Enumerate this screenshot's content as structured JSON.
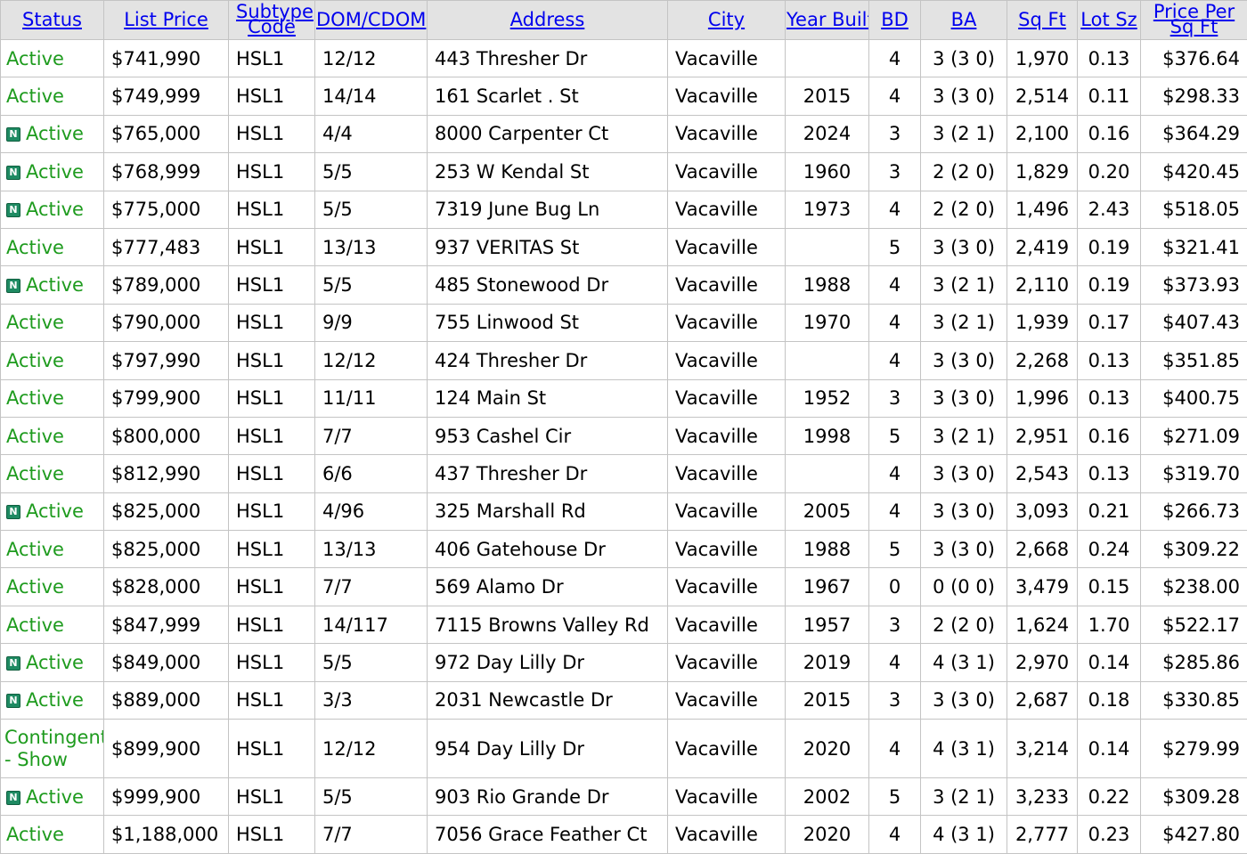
{
  "columns": [
    {
      "key": "status",
      "label": "Status",
      "width": 116
    },
    {
      "key": "list_price",
      "label": "List Price",
      "width": 140
    },
    {
      "key": "subtype",
      "label": "Subtype Code",
      "width": 97
    },
    {
      "key": "dom_cdom",
      "label": "DOM/CDOM",
      "width": 126
    },
    {
      "key": "address",
      "label": "Address",
      "width": 270
    },
    {
      "key": "city",
      "label": "City",
      "width": 132
    },
    {
      "key": "year_built",
      "label": "Year Built",
      "width": 94
    },
    {
      "key": "bd",
      "label": "BD",
      "width": 58
    },
    {
      "key": "ba",
      "label": "BA",
      "width": 97
    },
    {
      "key": "sqft",
      "label": "Sq Ft",
      "width": 79
    },
    {
      "key": "lot_sz",
      "label": "Lot Sz",
      "width": 71
    },
    {
      "key": "price_per_sqft",
      "label": "Price Per Sq Ft",
      "width": 120
    }
  ],
  "rows": [
    {
      "new": false,
      "status": "Active",
      "list_price": "$741,990",
      "subtype": "HSL1",
      "dom_cdom": "12/12",
      "address": "443 Thresher Dr",
      "city": "Vacaville",
      "year_built": "",
      "bd": "4",
      "ba": "3 (3 0)",
      "sqft": "1,970",
      "lot_sz": "0.13",
      "price_per_sqft": "$376.64"
    },
    {
      "new": false,
      "status": "Active",
      "list_price": "$749,999",
      "subtype": "HSL1",
      "dom_cdom": "14/14",
      "address": "161 Scarlet . St",
      "city": "Vacaville",
      "year_built": "2015",
      "bd": "4",
      "ba": "3 (3 0)",
      "sqft": "2,514",
      "lot_sz": "0.11",
      "price_per_sqft": "$298.33"
    },
    {
      "new": true,
      "status": "Active",
      "list_price": "$765,000",
      "subtype": "HSL1",
      "dom_cdom": "4/4",
      "address": "8000 Carpenter Ct",
      "city": "Vacaville",
      "year_built": "2024",
      "bd": "3",
      "ba": "3 (2 1)",
      "sqft": "2,100",
      "lot_sz": "0.16",
      "price_per_sqft": "$364.29"
    },
    {
      "new": true,
      "status": "Active",
      "list_price": "$768,999",
      "subtype": "HSL1",
      "dom_cdom": "5/5",
      "address": "253 W Kendal St",
      "city": "Vacaville",
      "year_built": "1960",
      "bd": "3",
      "ba": "2 (2 0)",
      "sqft": "1,829",
      "lot_sz": "0.20",
      "price_per_sqft": "$420.45"
    },
    {
      "new": true,
      "status": "Active",
      "list_price": "$775,000",
      "subtype": "HSL1",
      "dom_cdom": "5/5",
      "address": "7319 June Bug Ln",
      "city": "Vacaville",
      "year_built": "1973",
      "bd": "4",
      "ba": "2 (2 0)",
      "sqft": "1,496",
      "lot_sz": "2.43",
      "price_per_sqft": "$518.05"
    },
    {
      "new": false,
      "status": "Active",
      "list_price": "$777,483",
      "subtype": "HSL1",
      "dom_cdom": "13/13",
      "address": "937 VERITAS St",
      "city": "Vacaville",
      "year_built": "",
      "bd": "5",
      "ba": "3 (3 0)",
      "sqft": "2,419",
      "lot_sz": "0.19",
      "price_per_sqft": "$321.41"
    },
    {
      "new": true,
      "status": "Active",
      "list_price": "$789,000",
      "subtype": "HSL1",
      "dom_cdom": "5/5",
      "address": "485 Stonewood Dr",
      "city": "Vacaville",
      "year_built": "1988",
      "bd": "4",
      "ba": "3 (2 1)",
      "sqft": "2,110",
      "lot_sz": "0.19",
      "price_per_sqft": "$373.93"
    },
    {
      "new": false,
      "status": "Active",
      "list_price": "$790,000",
      "subtype": "HSL1",
      "dom_cdom": "9/9",
      "address": "755 Linwood St",
      "city": "Vacaville",
      "year_built": "1970",
      "bd": "4",
      "ba": "3 (2 1)",
      "sqft": "1,939",
      "lot_sz": "0.17",
      "price_per_sqft": "$407.43"
    },
    {
      "new": false,
      "status": "Active",
      "list_price": "$797,990",
      "subtype": "HSL1",
      "dom_cdom": "12/12",
      "address": "424 Thresher Dr",
      "city": "Vacaville",
      "year_built": "",
      "bd": "4",
      "ba": "3 (3 0)",
      "sqft": "2,268",
      "lot_sz": "0.13",
      "price_per_sqft": "$351.85"
    },
    {
      "new": false,
      "status": "Active",
      "list_price": "$799,900",
      "subtype": "HSL1",
      "dom_cdom": "11/11",
      "address": "124 Main St",
      "city": "Vacaville",
      "year_built": "1952",
      "bd": "3",
      "ba": "3 (3 0)",
      "sqft": "1,996",
      "lot_sz": "0.13",
      "price_per_sqft": "$400.75"
    },
    {
      "new": false,
      "status": "Active",
      "list_price": "$800,000",
      "subtype": "HSL1",
      "dom_cdom": "7/7",
      "address": "953 Cashel Cir",
      "city": "Vacaville",
      "year_built": "1998",
      "bd": "5",
      "ba": "3 (2 1)",
      "sqft": "2,951",
      "lot_sz": "0.16",
      "price_per_sqft": "$271.09"
    },
    {
      "new": false,
      "status": "Active",
      "list_price": "$812,990",
      "subtype": "HSL1",
      "dom_cdom": "6/6",
      "address": "437 Thresher Dr",
      "city": "Vacaville",
      "year_built": "",
      "bd": "4",
      "ba": "3 (3 0)",
      "sqft": "2,543",
      "lot_sz": "0.13",
      "price_per_sqft": "$319.70"
    },
    {
      "new": true,
      "status": "Active",
      "list_price": "$825,000",
      "subtype": "HSL1",
      "dom_cdom": "4/96",
      "address": "325 Marshall Rd",
      "city": "Vacaville",
      "year_built": "2005",
      "bd": "4",
      "ba": "3 (3 0)",
      "sqft": "3,093",
      "lot_sz": "0.21",
      "price_per_sqft": "$266.73"
    },
    {
      "new": false,
      "status": "Active",
      "list_price": "$825,000",
      "subtype": "HSL1",
      "dom_cdom": "13/13",
      "address": "406 Gatehouse Dr",
      "city": "Vacaville",
      "year_built": "1988",
      "bd": "5",
      "ba": "3 (3 0)",
      "sqft": "2,668",
      "lot_sz": "0.24",
      "price_per_sqft": "$309.22"
    },
    {
      "new": false,
      "status": "Active",
      "list_price": "$828,000",
      "subtype": "HSL1",
      "dom_cdom": "7/7",
      "address": "569 Alamo Dr",
      "city": "Vacaville",
      "year_built": "1967",
      "bd": "0",
      "ba": "0 (0 0)",
      "sqft": "3,479",
      "lot_sz": "0.15",
      "price_per_sqft": "$238.00"
    },
    {
      "new": false,
      "status": "Active",
      "list_price": "$847,999",
      "subtype": "HSL1",
      "dom_cdom": "14/117",
      "address": "7115 Browns Valley Rd",
      "city": "Vacaville",
      "year_built": "1957",
      "bd": "3",
      "ba": "2 (2 0)",
      "sqft": "1,624",
      "lot_sz": "1.70",
      "price_per_sqft": "$522.17"
    },
    {
      "new": true,
      "status": "Active",
      "list_price": "$849,000",
      "subtype": "HSL1",
      "dom_cdom": "5/5",
      "address": "972 Day Lilly Dr",
      "city": "Vacaville",
      "year_built": "2019",
      "bd": "4",
      "ba": "4 (3 1)",
      "sqft": "2,970",
      "lot_sz": "0.14",
      "price_per_sqft": "$285.86"
    },
    {
      "new": true,
      "status": "Active",
      "list_price": "$889,000",
      "subtype": "HSL1",
      "dom_cdom": "3/3",
      "address": "2031 Newcastle Dr",
      "city": "Vacaville",
      "year_built": "2015",
      "bd": "3",
      "ba": "3 (3 0)",
      "sqft": "2,687",
      "lot_sz": "0.18",
      "price_per_sqft": "$330.85"
    },
    {
      "new": false,
      "status": "Contingent - Show",
      "list_price": "$899,900",
      "subtype": "HSL1",
      "dom_cdom": "12/12",
      "address": "954 Day Lilly Dr",
      "city": "Vacaville",
      "year_built": "2020",
      "bd": "4",
      "ba": "4 (3 1)",
      "sqft": "3,214",
      "lot_sz": "0.14",
      "price_per_sqft": "$279.99"
    },
    {
      "new": true,
      "status": "Active",
      "list_price": "$999,900",
      "subtype": "HSL1",
      "dom_cdom": "5/5",
      "address": "903 Rio Grande Dr",
      "city": "Vacaville",
      "year_built": "2002",
      "bd": "5",
      "ba": "3 (2 1)",
      "sqft": "3,233",
      "lot_sz": "0.22",
      "price_per_sqft": "$309.28"
    },
    {
      "new": false,
      "status": "Active",
      "list_price": "$1,188,000",
      "subtype": "HSL1",
      "dom_cdom": "7/7",
      "address": "7056 Grace Feather Ct",
      "city": "Vacaville",
      "year_built": "2020",
      "bd": "4",
      "ba": "4 (3 1)",
      "sqft": "2,777",
      "lot_sz": "0.23",
      "price_per_sqft": "$427.80"
    }
  ],
  "badge": {
    "label": "N"
  },
  "colors": {
    "link": "#0000ee",
    "status_green": "#1e9b1e",
    "badge_bg": "#1e8a62",
    "header_bg": "#e3e3e3",
    "border": "#c4c4c4"
  }
}
